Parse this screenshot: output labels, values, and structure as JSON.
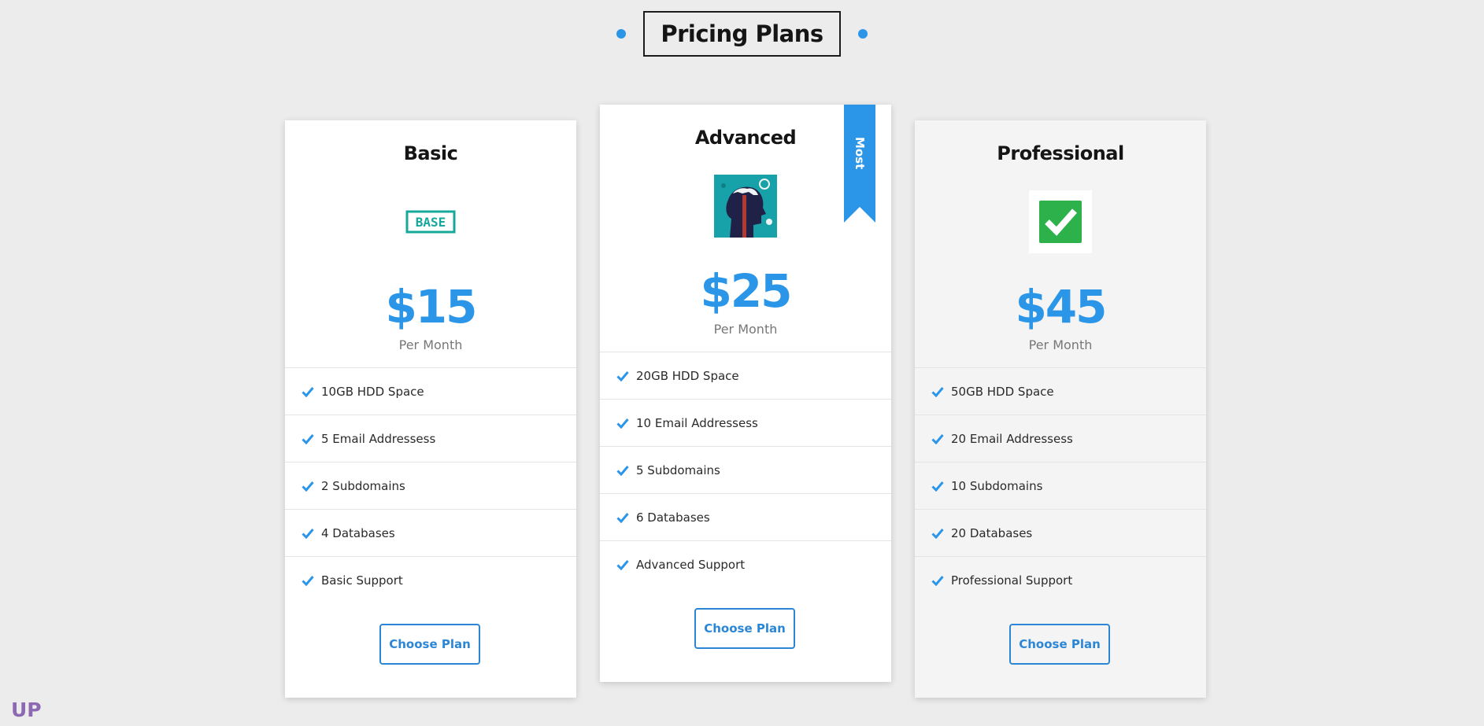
{
  "page": {
    "title": "Pricing Plans",
    "corner_logo": "UP"
  },
  "colors": {
    "accent": "#2b95e8",
    "background": "#ececec",
    "card": "#ffffff",
    "card_alt": "#f4f4f4",
    "logo_purple": "#8e69b3"
  },
  "plans": [
    {
      "name": "Basic",
      "icon": "base-logo-icon",
      "logo_text": "BASE",
      "price": "$15",
      "period": "Per Month",
      "features": [
        "10GB HDD Space",
        "5 Email Addressess",
        "2 Subdomains",
        "4 Databases",
        "Basic Support"
      ],
      "button": "Choose Plan"
    },
    {
      "name": "Advanced",
      "icon": "head-gears-icon",
      "badge": "Most Popular",
      "price": "$25",
      "period": "Per Month",
      "features": [
        "20GB HDD Space",
        "10 Email Addressess",
        "5 Subdomains",
        "6 Databases",
        "Advanced Support"
      ],
      "button": "Choose Plan"
    },
    {
      "name": "Professional",
      "icon": "checkmark-icon",
      "price": "$45",
      "period": "Per Month",
      "features": [
        "50GB HDD Space",
        "20 Email Addressess",
        "10 Subdomains",
        "20 Databases",
        "Professional Support"
      ],
      "button": "Choose Plan"
    }
  ]
}
